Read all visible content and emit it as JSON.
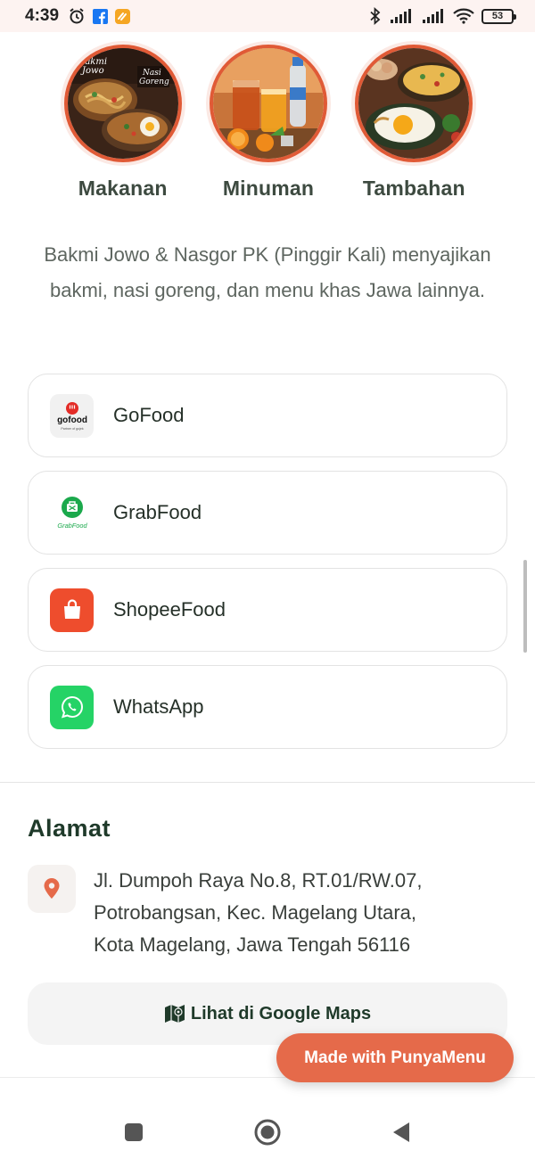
{
  "status_bar": {
    "time": "4:39",
    "battery": "53"
  },
  "categories": [
    {
      "label": "Makanan",
      "image_text_1": "Bakmi",
      "image_text_2": "Jowo",
      "image_text_3": "Nasi",
      "image_text_4": "Goreng"
    },
    {
      "label": "Minuman"
    },
    {
      "label": "Tambahan"
    }
  ],
  "description": "Bakmi Jowo & Nasgor PK (Pinggir Kali) menyajikan bakmi, nasi goreng, dan menu khas Jawa lainnya.",
  "order_links": [
    {
      "label": "GoFood",
      "icon": "gofood-icon",
      "icon_text": "gofood",
      "icon_subtext": "Partner of gojek"
    },
    {
      "label": "GrabFood",
      "icon": "grabfood-icon",
      "icon_text": "GrabFood"
    },
    {
      "label": "ShopeeFood",
      "icon": "shopeefood-icon"
    },
    {
      "label": "WhatsApp",
      "icon": "whatsapp-icon"
    }
  ],
  "address": {
    "title": "Alamat",
    "line1": "Jl. Dumpoh Raya No.8, RT.01/RW.07,",
    "line2": "Potrobangsan, Kec. Magelang Utara,",
    "line3": "Kota Magelang, Jawa Tengah 56116"
  },
  "maps_button": {
    "label": "Lihat di Google Maps"
  },
  "made_with": {
    "label": "Made with PunyaMenu"
  },
  "colors": {
    "accent": "#e56a4a",
    "heading": "#1f3a2a",
    "gofood": "#e32c27",
    "grabfood": "#1ba94c",
    "shopeefood": "#ee4d2d",
    "whatsapp": "#25d366"
  }
}
